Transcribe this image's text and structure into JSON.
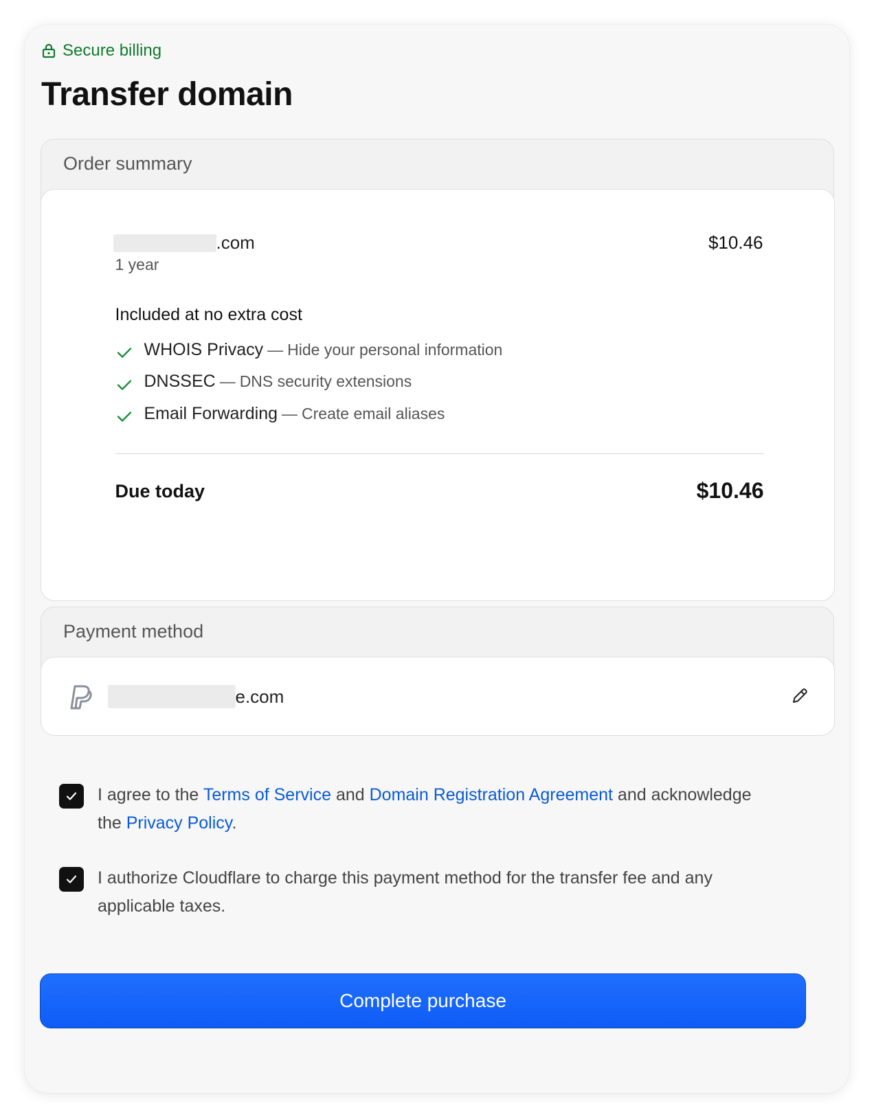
{
  "header": {
    "secure_label": "Secure billing",
    "title": "Transfer domain"
  },
  "order_summary": {
    "heading": "Order summary",
    "domain_suffix": ".com",
    "term": "1 year",
    "price": "$10.46",
    "included_title": "Included at no extra cost",
    "features": [
      {
        "name": "WHOIS Privacy",
        "separator": "—",
        "description": "Hide your personal information"
      },
      {
        "name": "DNSSEC",
        "separator": "—",
        "description": "DNS security extensions"
      },
      {
        "name": "Email Forwarding",
        "separator": "—",
        "description": "Create email aliases"
      }
    ],
    "due_label": "Due today",
    "due_amount": "$10.46"
  },
  "payment_method": {
    "heading": "Payment method",
    "account_suffix": "e.com",
    "provider_icon": "paypal-icon",
    "edit_icon": "pencil-icon"
  },
  "agreements": {
    "terms": {
      "checked": true,
      "part1": "I agree to the ",
      "link_tos": "Terms of Service",
      "part2": " and ",
      "link_dra": "Domain Registration Agreement",
      "part3": " and acknowledge the ",
      "link_privacy": "Privacy Policy",
      "part4": "."
    },
    "authorize": {
      "checked": true,
      "text": "I authorize Cloudflare to charge this payment method for the transfer fee and any applicable taxes."
    }
  },
  "cta": {
    "label": "Complete purchase"
  },
  "colors": {
    "secure_green": "#127a2e",
    "check_green": "#1a8f3c",
    "link_blue": "#0a5bd8",
    "button_blue": "#1464fa"
  }
}
